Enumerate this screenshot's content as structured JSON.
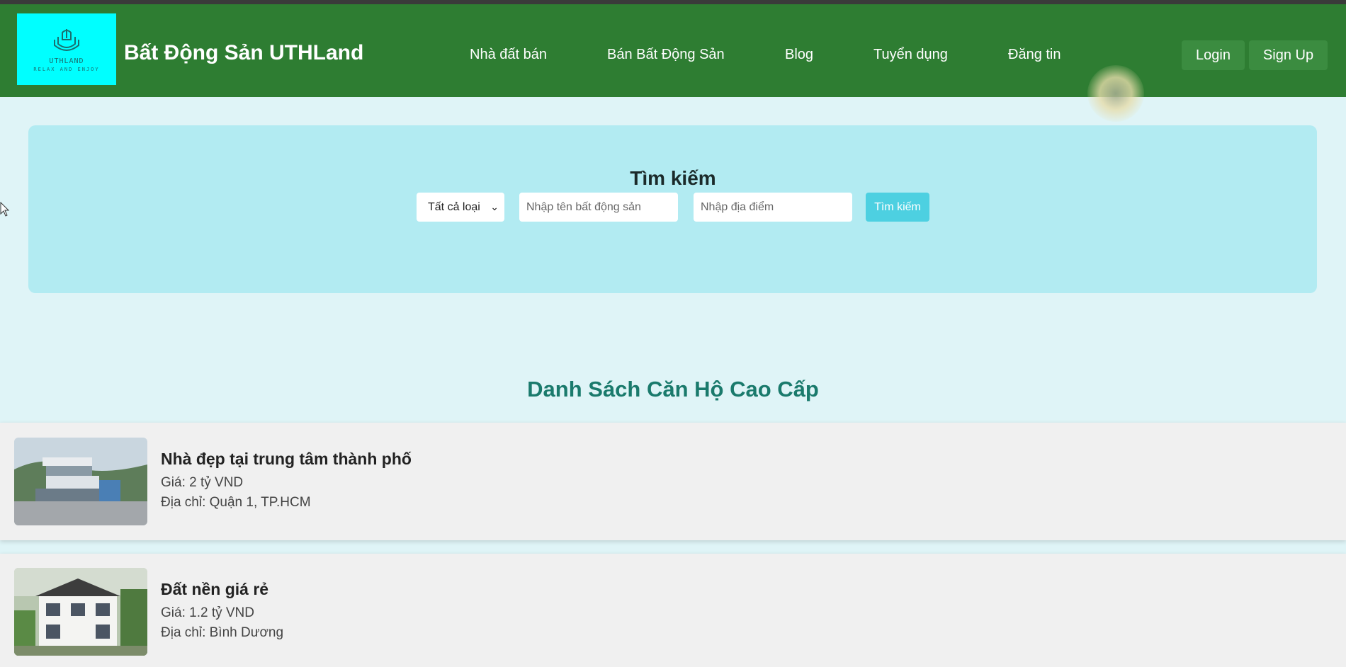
{
  "header": {
    "logo": {
      "name": "UTHLAND",
      "tagline": "RELAX AND ENJOY",
      "icon": "house-logo-icon"
    },
    "site_title": "Bất Động Sản UTHLand",
    "nav": [
      {
        "label": "Nhà đất bán"
      },
      {
        "label": "Bán Bất Động Sản"
      },
      {
        "label": "Blog"
      },
      {
        "label": "Tuyển dụng"
      },
      {
        "label": "Đăng tin"
      }
    ],
    "login_label": "Login",
    "signup_label": "Sign Up"
  },
  "search": {
    "title": "Tìm kiếm",
    "type_selected": "Tất cả loại",
    "name_placeholder": "Nhập tên bất động sản",
    "location_placeholder": "Nhập địa điểm",
    "button_label": "Tìm kiếm"
  },
  "listings_section": {
    "title": "Danh Sách Căn Hộ Cao Cấp",
    "items": [
      {
        "name": "Nhà đẹp tại trung tâm thành phố",
        "price": "Giá: 2 tỷ VND",
        "address": "Địa chỉ: Quận 1, TP.HCM"
      },
      {
        "name": "Đất nền giá rẻ",
        "price": "Giá: 1.2 tỷ VND",
        "address": "Địa chỉ: Bình Dương"
      }
    ]
  },
  "colors": {
    "nav_bg": "#2e7d32",
    "page_bg": "#dff4f7",
    "search_panel": "#b2ebf2",
    "search_button": "#4dd0e1",
    "section_title": "#1a7a6c"
  }
}
